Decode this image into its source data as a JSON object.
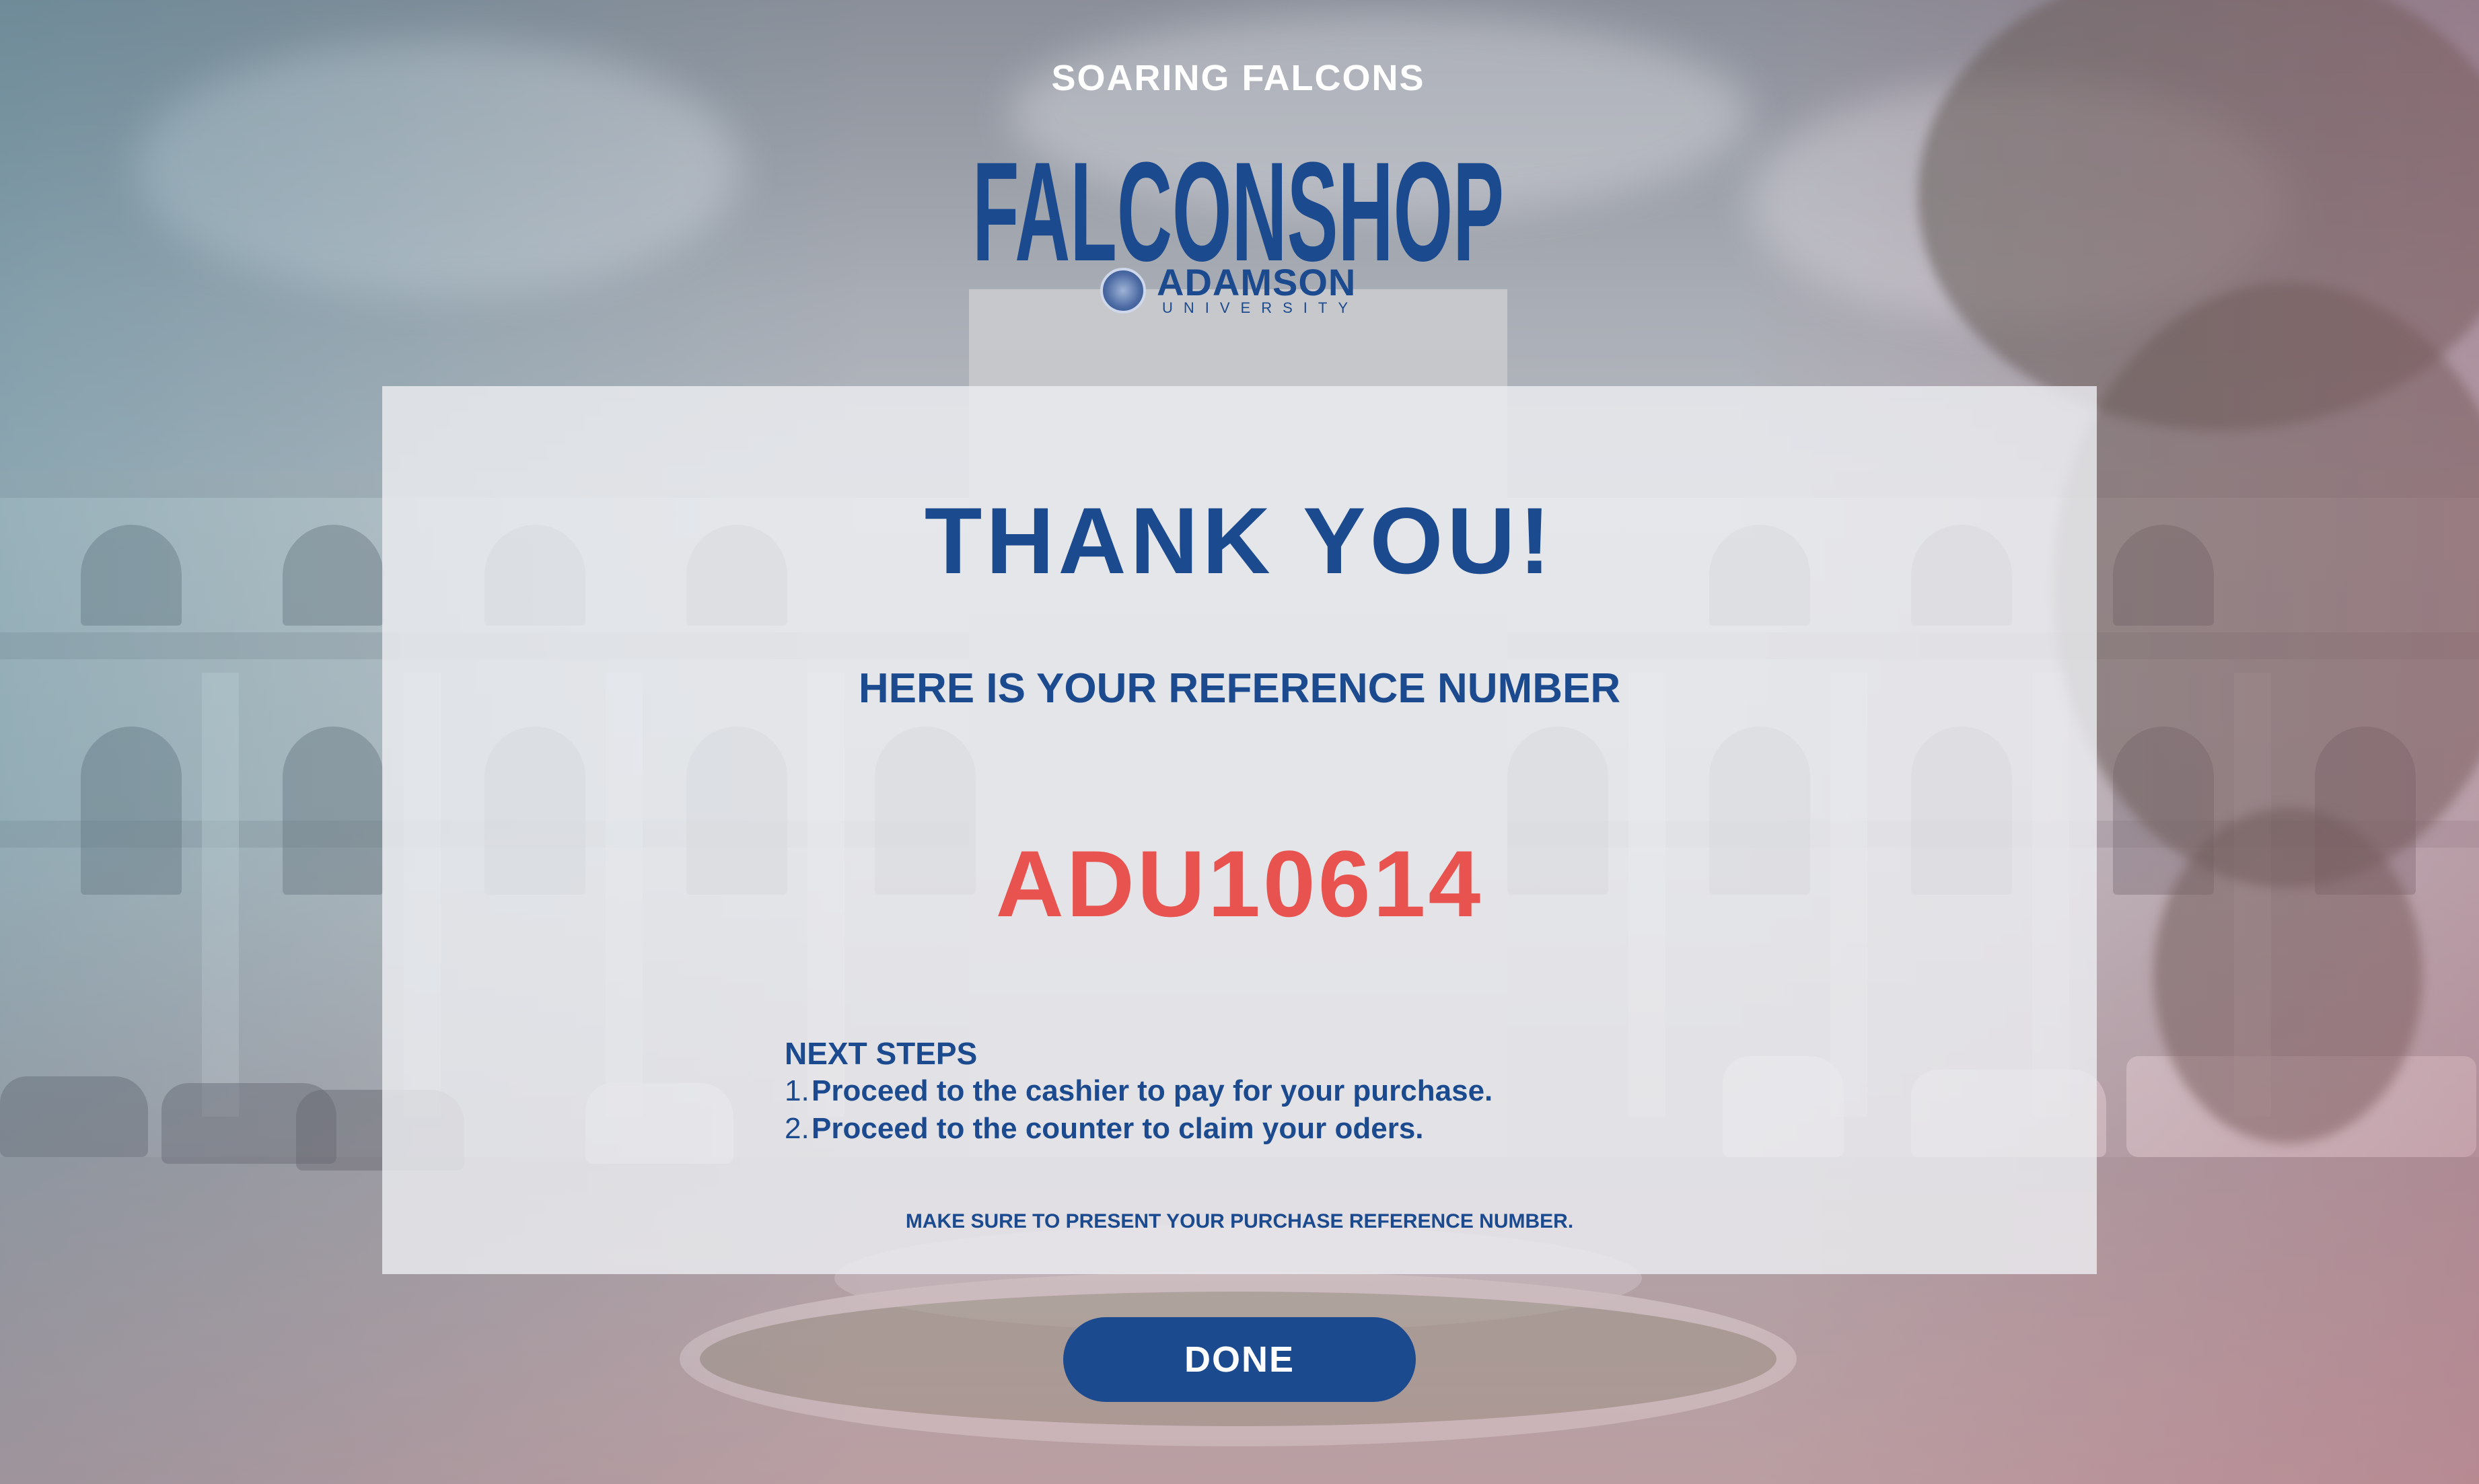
{
  "logo": {
    "tagline": "SOARING FALCONS",
    "wordmark": "FALCONSHOP",
    "university_name": "ADAMSON",
    "university_sub": "UNIVERSITY",
    "seal_icon": "university-seal-icon"
  },
  "confirmation": {
    "title": "THANK YOU!",
    "subtitle": "HERE IS YOUR REFERENCE NUMBER",
    "reference_number": "ADU10614"
  },
  "next_steps": {
    "heading": "NEXT STEPS",
    "items": [
      {
        "number": "1.",
        "text": "Proceed to the cashier to pay for your purchase."
      },
      {
        "number": "2.",
        "text": "Proceed to the counter to claim your oders."
      }
    ]
  },
  "note": "MAKE SURE TO PRESENT YOUR PURCHASE REFERENCE NUMBER.",
  "actions": {
    "done_label": "DONE"
  },
  "colors": {
    "primary": "#1c4a8f",
    "accent": "#e8534f",
    "card_background": "#ecedf0"
  }
}
